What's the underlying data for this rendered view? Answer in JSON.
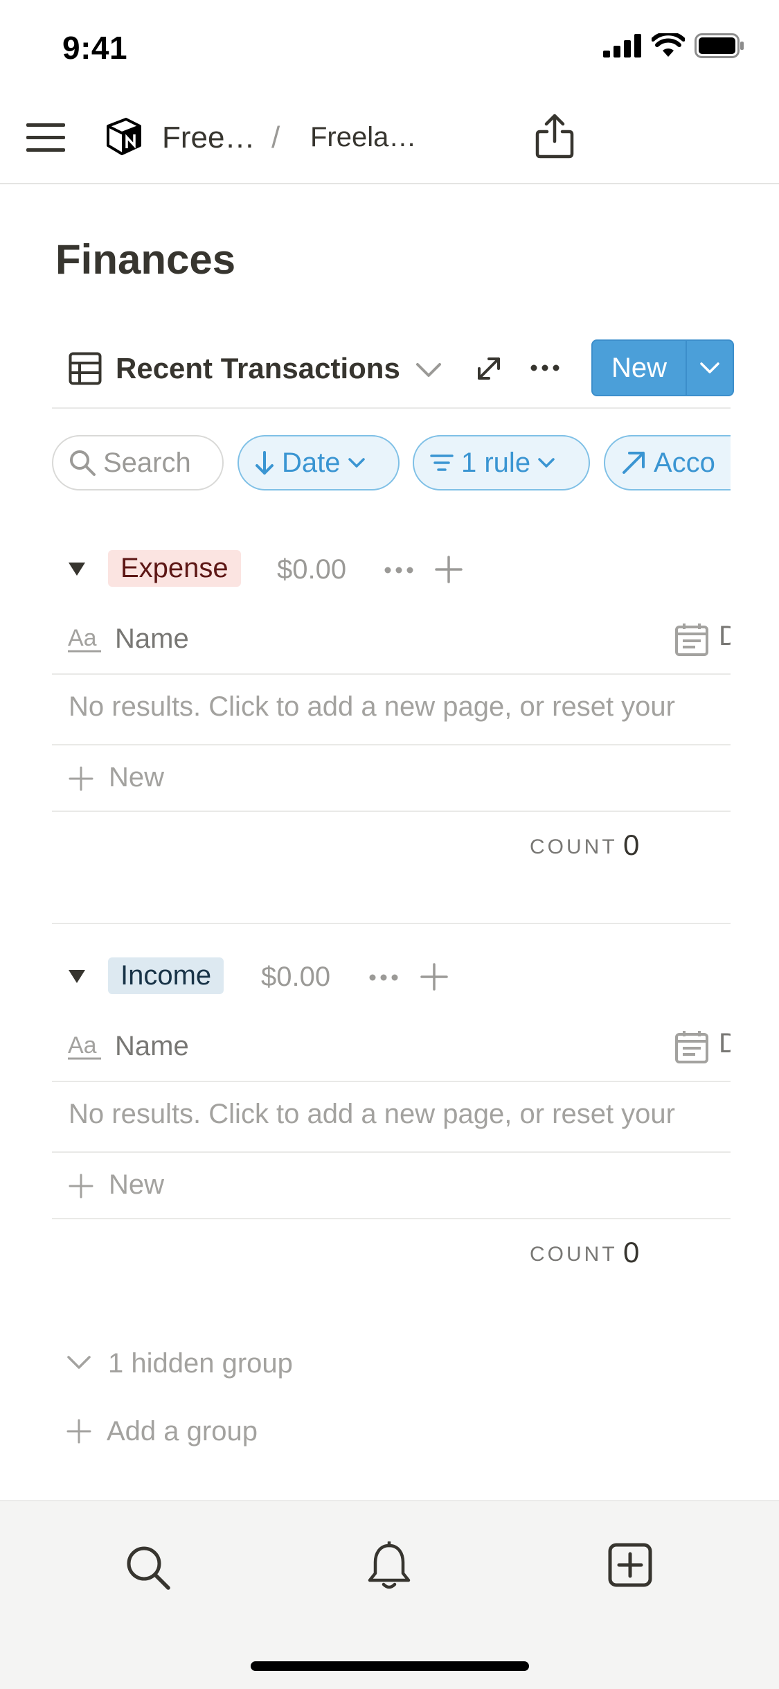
{
  "status_bar": {
    "time": "9:41"
  },
  "nav": {
    "breadcrumb_1": "Free…",
    "separator": "/",
    "breadcrumb_2": "Freela…"
  },
  "page": {
    "title": "Finances"
  },
  "view": {
    "name": "Recent Transactions",
    "new_label": "New"
  },
  "filters": {
    "search": "Search",
    "sort": "Date",
    "rule": "1 rule",
    "account": "Acco"
  },
  "groups": [
    {
      "label": "Expense",
      "amount": "$0.00",
      "tag_bg": "#fbe4e1",
      "tag_color": "#5d1715",
      "header_name": "Name",
      "header_date_fragment": "D",
      "empty_text": "No results. Click to add a new page, or reset your",
      "new_row": "New",
      "count_label": "COUNT",
      "count_value": "0"
    },
    {
      "label": "Income",
      "amount": "$0.00",
      "tag_bg": "#dde9f1",
      "tag_color": "#183347",
      "header_name": "Name",
      "header_date_fragment": "D",
      "empty_text": "No results. Click to add a new page, or reset your",
      "new_row": "New",
      "count_label": "COUNT",
      "count_value": "0"
    }
  ],
  "footer": {
    "hidden_groups": "1 hidden group",
    "add_group": "Add a group"
  },
  "tabbar": {
    "items": [
      "search-icon",
      "bell-icon",
      "new-page-icon"
    ]
  },
  "colors": {
    "accent": "#4b9fd9",
    "chip_blue": "#3a95d2",
    "text": "#37352f",
    "muted": "#9b9a97"
  }
}
